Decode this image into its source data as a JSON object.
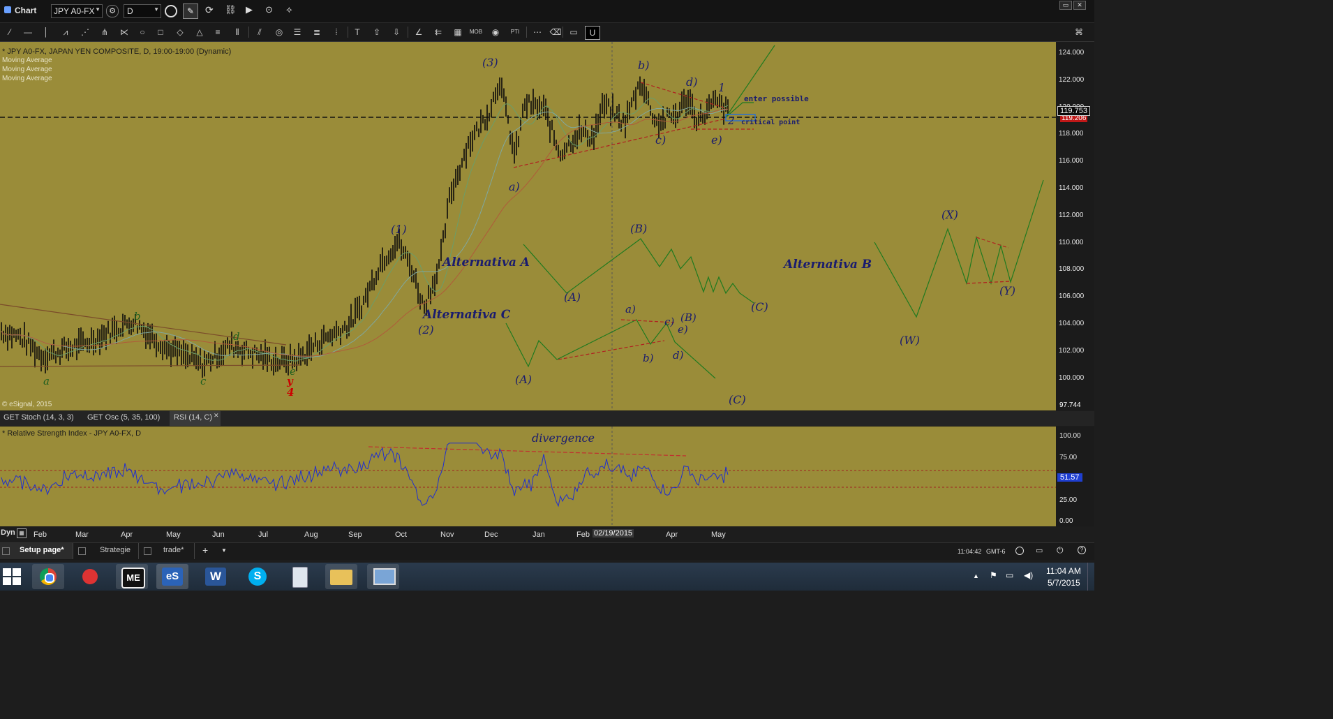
{
  "window": {
    "title": "Chart",
    "symbol": "JPY A0-FX",
    "interval": "D"
  },
  "chart": {
    "header": "* JPY A0-FX, JAPAN YEN COMPOSITE, D, 19:00-19:00 (Dynamic)",
    "studies": [
      "Moving Average",
      "Moving Average",
      "Moving Average"
    ],
    "copyright": "© eSignal, 2015"
  },
  "price_axis": {
    "ticks": [
      "124.000",
      "122.000",
      "120.000",
      "118.000",
      "116.000",
      "114.000",
      "112.000",
      "110.000",
      "108.000",
      "106.000",
      "104.000",
      "102.000",
      "100.000"
    ],
    "last_price": "119.753",
    "last_price_color": "#0b0b0b",
    "hidden_label": "119.206",
    "bottom_label": "97.744"
  },
  "study_tabs": [
    "GET Stoch (14, 3, 3)",
    "GET Osc (5, 35, 100)",
    "RSI (14, C)"
  ],
  "rsi": {
    "header": "* Relative Strength Index - JPY A0-FX, D",
    "ticks": [
      "100.00",
      "75.00",
      "50.00",
      "25.00",
      "0.00"
    ],
    "value": "51.57",
    "value_color": "#1f3fd0",
    "label": "divergence"
  },
  "time_axis": {
    "corner": "Dyn",
    "months": [
      "Feb",
      "Mar",
      "Apr",
      "May",
      "Jun",
      "Jul",
      "Aug",
      "Sep",
      "Oct",
      "Nov",
      "Dec",
      "Jan",
      "Feb",
      "Apr",
      "May"
    ],
    "cursor_date": "02/19/2015"
  },
  "annotations": {
    "wave3": "(3)",
    "wave1": "(1)",
    "wave2": "(2)",
    "b_upper": "b)",
    "d_upper": "d)",
    "one": "1",
    "two": "2",
    "enter": "enter possible",
    "critical": "critical point",
    "c_upper": "c)",
    "e_upper": "e)",
    "a_upper": "a)",
    "altA": "Alternativa A",
    "altB": "Alternativa B",
    "altC": "Alternativa C",
    "B_mid": "(B)",
    "A_mid": "(A)",
    "C_mid": "(C)",
    "X": "(X)",
    "W": "(W)",
    "Y": "(Y)",
    "a_low": "a)",
    "c_low": "c)",
    "B_low": "(B)",
    "e_low": "e)",
    "b_low": "b)",
    "d_low": "d)",
    "A_low": "(A)",
    "C_low": "(C)",
    "w_b": "b",
    "w_d": "d",
    "w_a": "a",
    "w_c": "c",
    "w_e": "e",
    "y": "y",
    "four": "4"
  },
  "page_tabs": [
    "Setup page*",
    "Strategie",
    "trade*"
  ],
  "status": {
    "time": "11:04:42",
    "tz": "GMT-6"
  },
  "taskbar": {
    "clock": "11:04 AM",
    "date": "5/7/2015"
  },
  "icons": [
    "gear-icon",
    "clock-icon",
    "pencil-icon",
    "cursor-icon",
    "chrome-icon",
    "word-icon",
    "skype-icon",
    "folder-icon",
    "calculator-icon",
    "network-icon"
  ]
}
